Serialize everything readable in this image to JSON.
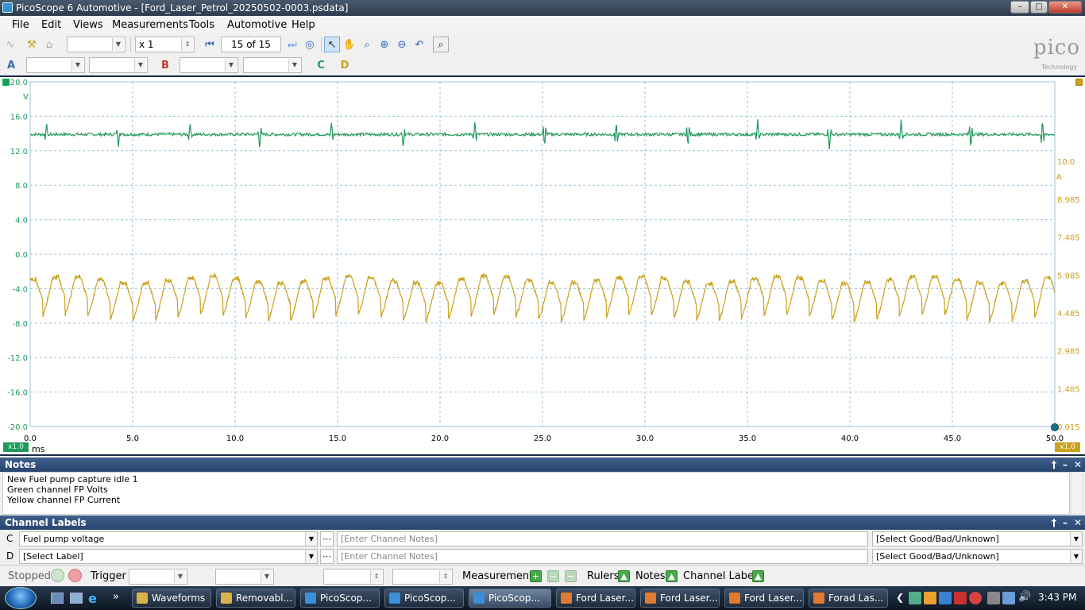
{
  "window": {
    "title": "PicoScope 6 Automotive - [Ford_Laser_Petrol_20250502-0003.psdata]"
  },
  "menu": [
    "File",
    "Edit",
    "Views",
    "Measurements",
    "Tools",
    "Automotive",
    "Help"
  ],
  "toolbar": {
    "zoom_value": "x 1",
    "buffer_position": "15 of 15",
    "channel_a": "A",
    "channel_b": "B",
    "channel_c": "C",
    "channel_d": "D"
  },
  "logo": {
    "name": "pico",
    "sub": "Technology"
  },
  "scope": {
    "left_unit": "V",
    "right_unit": "A",
    "x_unit": "ms",
    "left_scale_badge": "x1.0",
    "right_scale_badge": "x1.0",
    "colors": {
      "green": "#1f9a5b",
      "yellow": "#c9a21f",
      "grid": "#9cc2d8"
    }
  },
  "chart_data": {
    "type": "line",
    "xlabel": "ms",
    "xlim": [
      0,
      50
    ],
    "x_ticks": [
      "0.0",
      "5.0",
      "10.0",
      "15.0",
      "20.0",
      "25.0",
      "30.0",
      "35.0",
      "40.0",
      "45.0",
      "50.0"
    ],
    "ylabel_left": "V",
    "ylim_left": [
      -20,
      20
    ],
    "y_ticks_left": [
      "20.0",
      "16.0",
      "12.0",
      "8.0",
      "4.0",
      "0.0",
      "-4.0",
      "-8.0",
      "-12.0",
      "-16.0",
      "-20.0"
    ],
    "ylabel_right": "A",
    "y_ticks_right": [
      "10.0",
      "8.985",
      "7.485",
      "5.985",
      "4.485",
      "2.985",
      "1.485",
      "0.015"
    ],
    "grid": true,
    "series": [
      {
        "name": "Fuel pump voltage",
        "axis": "left",
        "color": "#1f9a5b",
        "baseline": 13.9,
        "spike_x": [
          0.8,
          4.3,
          7.8,
          11.2,
          14.7,
          18.2,
          21.7,
          25.1,
          28.6,
          32.1,
          35.5,
          39.0,
          42.5,
          45.9,
          49.4
        ]
      },
      {
        "name": "Yellow channel FP Current",
        "axis": "left",
        "color": "#c9a21f",
        "mean": -4.8,
        "ripple_period_ms": 1.1,
        "peak": -3.0,
        "trough": -7.5
      }
    ]
  },
  "notes": {
    "title": "Notes",
    "lines": [
      "New Fuel pump capture idle 1",
      "Green channel FP Volts",
      "Yellow channel FP Current"
    ]
  },
  "channel_labels": {
    "title": "Channel Labels",
    "rows": [
      {
        "ch": "C",
        "label": "Fuel pump voltage",
        "notes": "[Enter Channel Notes]",
        "quality": "[Select Good/Bad/Unknown]"
      },
      {
        "ch": "D",
        "label": "[Select Label]",
        "notes": "[Enter Channel Notes]",
        "quality": "[Select Good/Bad/Unknown]"
      }
    ]
  },
  "status": {
    "state": "Stopped",
    "trigger": "Trigger",
    "measurements": "Measurements",
    "rulers": "Rulers",
    "notes": "Notes",
    "channel_labels": "Channel Labels"
  },
  "taskbar": {
    "items": [
      "Waveforms",
      "Removabl...",
      "PicoScop...",
      "PicoScop...",
      "PicoScop...",
      "Ford Laser...",
      "Ford Laser...",
      "Ford Laser...",
      "Forad Las..."
    ],
    "clock": "3:43 PM"
  }
}
